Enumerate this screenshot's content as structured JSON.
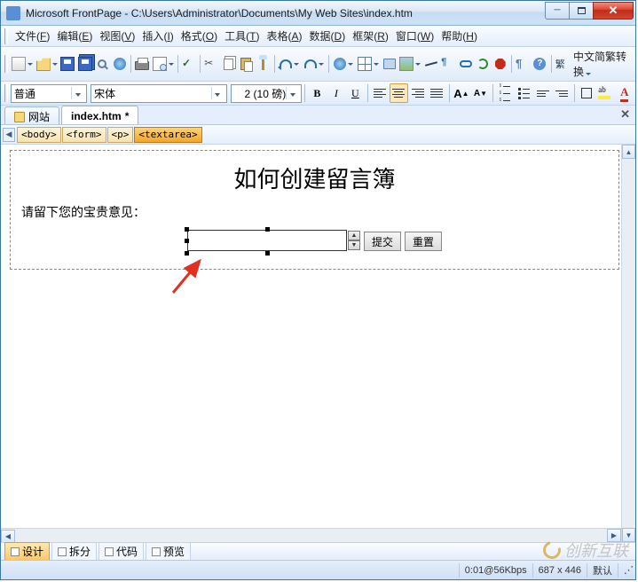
{
  "title": "Microsoft FrontPage - C:\\Users\\Administrator\\Documents\\My Web Sites\\index.htm",
  "menus": [
    {
      "label": "文件",
      "mn": "F"
    },
    {
      "label": "编辑",
      "mn": "E"
    },
    {
      "label": "视图",
      "mn": "V"
    },
    {
      "label": "插入",
      "mn": "I"
    },
    {
      "label": "格式",
      "mn": "O"
    },
    {
      "label": "工具",
      "mn": "T"
    },
    {
      "label": "表格",
      "mn": "A"
    },
    {
      "label": "数据",
      "mn": "D"
    },
    {
      "label": "框架",
      "mn": "R"
    },
    {
      "label": "窗口",
      "mn": "W"
    },
    {
      "label": "帮助",
      "mn": "H"
    }
  ],
  "cjk_convert": "中文简繁转换",
  "format": {
    "style": "普通",
    "font": "宋体",
    "size": "2 (10 磅)"
  },
  "tabs": [
    {
      "label": "网站"
    },
    {
      "label": "index.htm",
      "active": true,
      "dirty": "*"
    }
  ],
  "breadcrumb": [
    "<body>",
    "<form>",
    "<p>",
    "<textarea>"
  ],
  "doc": {
    "heading": "如何创建留言簿",
    "prompt": "请留下您的宝贵意见：",
    "submit": "提交",
    "reset": "重置"
  },
  "views": [
    {
      "label": "设计",
      "active": true,
      "ico": "□"
    },
    {
      "label": "拆分",
      "ico": "⊟"
    },
    {
      "label": "代码",
      "ico": "▥"
    },
    {
      "label": "预览",
      "ico": "Q"
    }
  ],
  "status": {
    "speed": "0:01@56Kbps",
    "size": "687 x 446",
    "mode": "默认"
  },
  "watermark": "创新互联"
}
